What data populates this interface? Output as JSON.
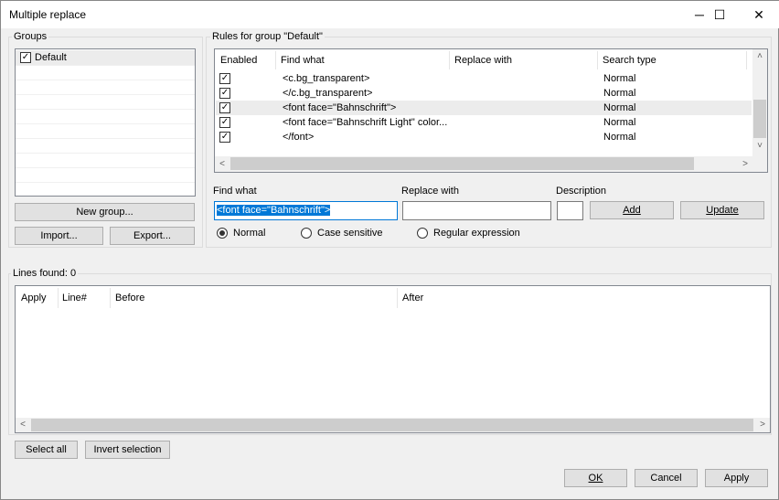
{
  "window": {
    "title": "Multiple replace",
    "minimize": "─",
    "maximize": "☐",
    "close": "✕"
  },
  "groups": {
    "legend": "Groups",
    "items": [
      {
        "label": "Default",
        "checked": true,
        "selected": true
      }
    ],
    "new_group": "New group...",
    "import": "Import...",
    "export": "Export..."
  },
  "rules": {
    "legend": "Rules for group \"Default\"",
    "columns": [
      "Enabled",
      "Find what",
      "Replace with",
      "Search type"
    ],
    "rows": [
      {
        "enabled": true,
        "find": "<c.bg_transparent>",
        "replace": "",
        "type": "Normal"
      },
      {
        "enabled": true,
        "find": "</c.bg_transparent>",
        "replace": "",
        "type": "Normal"
      },
      {
        "enabled": true,
        "find": "<font face=\"Bahnschrift\">",
        "replace": "",
        "type": "Normal",
        "selected": true
      },
      {
        "enabled": true,
        "find": "<font face=\"Bahnschrift Light\" color...",
        "replace": "",
        "type": "Normal"
      },
      {
        "enabled": true,
        "find": "</font>",
        "replace": "",
        "type": "Normal"
      }
    ]
  },
  "editor": {
    "find_label": "Find what",
    "find_value": "<font face=\"Bahnschrift\">",
    "replace_label": "Replace with",
    "replace_value": "",
    "desc_label": "Description",
    "desc_value": "",
    "add": "Add",
    "update": "Update",
    "modes": [
      "Normal",
      "Case sensitive",
      "Regular expression"
    ],
    "selected_mode": "Normal"
  },
  "lines": {
    "legend": "Lines found: 0",
    "columns": [
      "Apply",
      "Line#",
      "Before",
      "After"
    ],
    "select_all": "Select all",
    "invert": "Invert selection"
  },
  "footer": {
    "ok": "OK",
    "cancel": "Cancel",
    "apply": "Apply"
  },
  "colors": {
    "selection": "#0078d7",
    "row_selected": "#ececec"
  }
}
